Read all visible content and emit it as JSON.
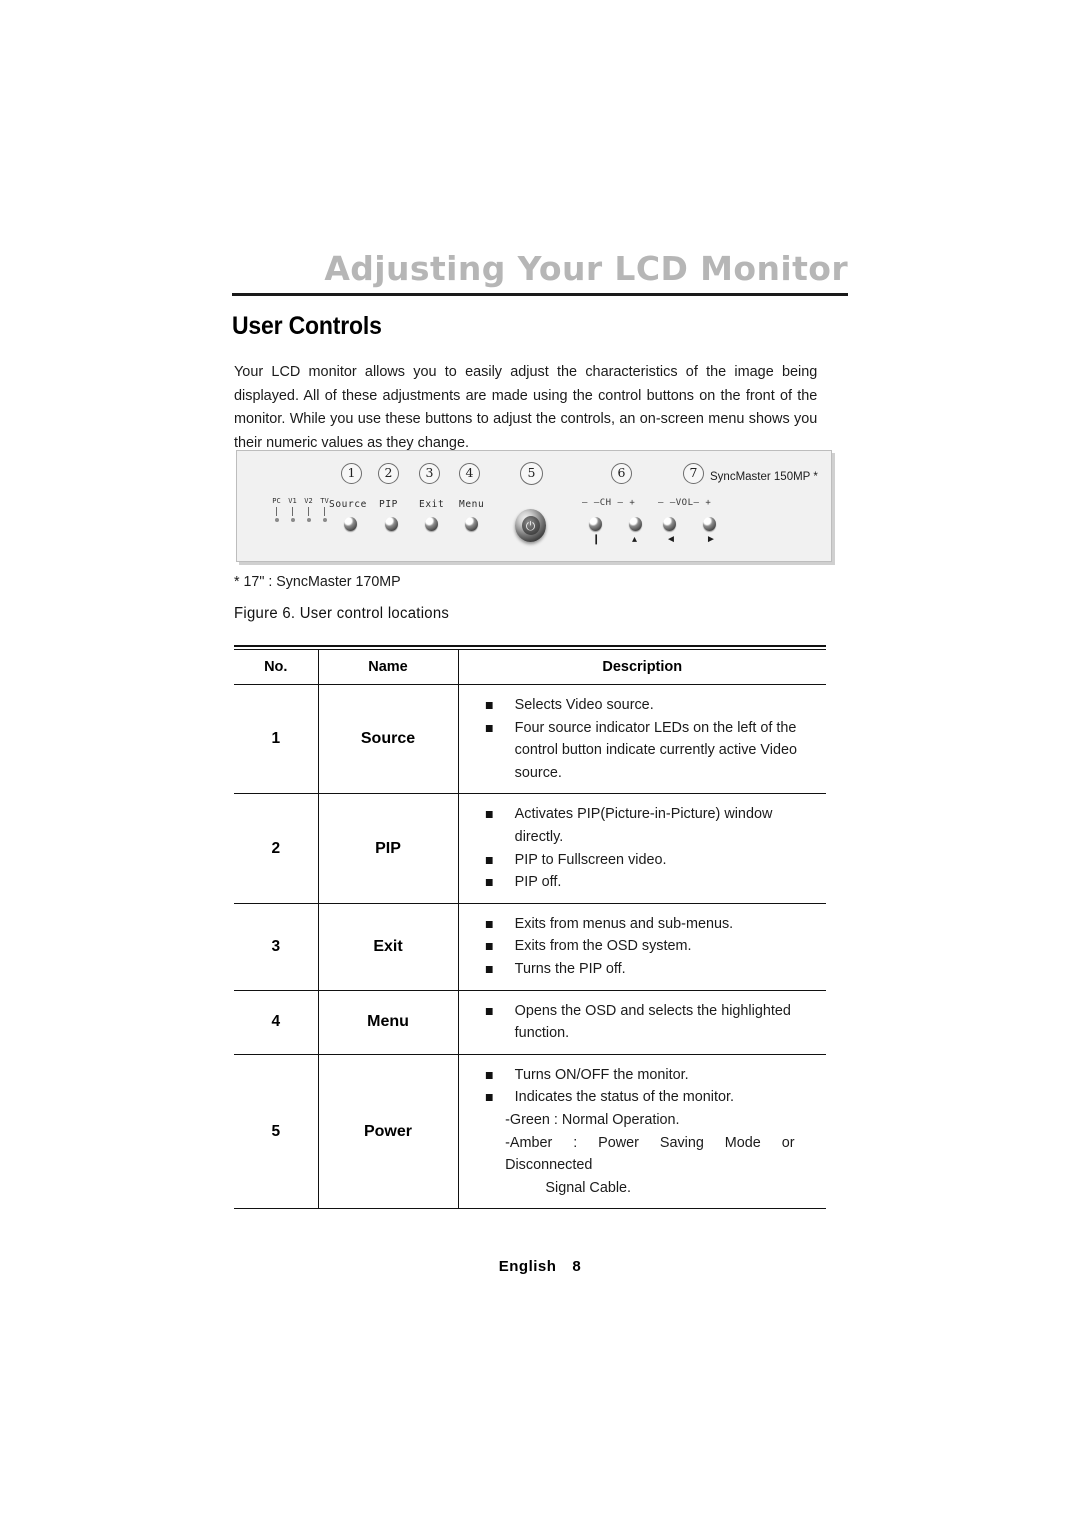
{
  "chapter": {
    "title": "Adjusting Your LCD Monitor"
  },
  "section": {
    "title": "User Controls",
    "intro": "Your LCD monitor allows you to easily adjust the characteristics of the image being displayed. All of these adjustments are made using the control buttons on the front of the monitor. While you use these buttons to adjust the controls, an on-screen menu shows you their numeric values as they change."
  },
  "figure": {
    "footnote": "* 17\" : SyncMaster 170MP",
    "caption": "Figure 6.  User control locations",
    "model_name": "SyncMaster 150MP *",
    "callouts": [
      "1",
      "2",
      "3",
      "4",
      "5",
      "6",
      "7"
    ],
    "led_labels": [
      "PC",
      "V1",
      "V2",
      "TV"
    ],
    "button_labels": [
      "Source",
      "PIP",
      "Exit",
      "Menu"
    ],
    "ch_label": "– —CH — +",
    "vol_label": "– —VOL— +",
    "power_glyph": "⏻",
    "arrows": [
      "❙",
      "▴",
      "◄",
      "►"
    ]
  },
  "table": {
    "headers": {
      "no": "No.",
      "name": "Name",
      "description": "Description"
    },
    "rows": [
      {
        "no": "1",
        "name": "Source",
        "lines": [
          {
            "type": "bullet",
            "text": "Selects Video source."
          },
          {
            "type": "bullet",
            "text": "Four source indicator LEDs on the left of the"
          },
          {
            "type": "cont",
            "text": "control button indicate currently active Video"
          },
          {
            "type": "cont",
            "text": "source."
          }
        ]
      },
      {
        "no": "2",
        "name": "PIP",
        "lines": [
          {
            "type": "bullet",
            "text": "Activates PIP(Picture-in-Picture) window"
          },
          {
            "type": "cont",
            "text": "directly."
          },
          {
            "type": "bullet",
            "text": "PIP to Fullscreen video."
          },
          {
            "type": "bullet",
            "text": "PIP off."
          }
        ]
      },
      {
        "no": "3",
        "name": "Exit",
        "lines": [
          {
            "type": "bullet",
            "text": "Exits from menus and sub-menus."
          },
          {
            "type": "bullet",
            "text": "Exits from the OSD system."
          },
          {
            "type": "bullet",
            "text": "Turns the PIP off."
          }
        ]
      },
      {
        "no": "4",
        "name": "Menu",
        "lines": [
          {
            "type": "bullet",
            "text": "Opens the OSD and selects the highlighted"
          },
          {
            "type": "cont",
            "text": "function."
          }
        ]
      },
      {
        "no": "5",
        "name": "Power",
        "lines": [
          {
            "type": "bullet",
            "text": "Turns ON/OFF the monitor."
          },
          {
            "type": "bullet",
            "text": "Indicates the status of the monitor."
          },
          {
            "type": "sub",
            "text": "-Green : Normal Operation."
          },
          {
            "type": "subjust",
            "text": "-Amber : Power Saving Mode or Disconnected"
          },
          {
            "type": "indent2",
            "text": "Signal Cable."
          }
        ]
      }
    ]
  },
  "footer": {
    "language": "English",
    "page": "8"
  }
}
